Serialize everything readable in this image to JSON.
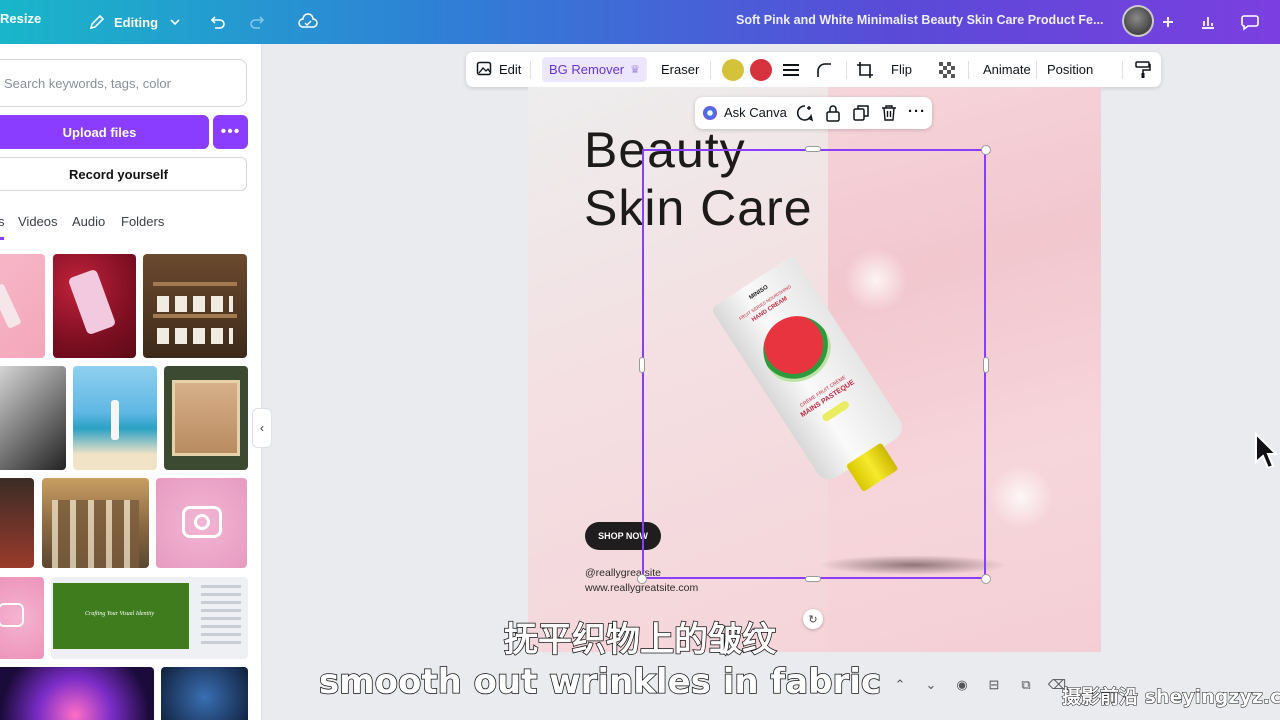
{
  "topbar": {
    "resize_label": "Resize",
    "editing_label": "Editing",
    "doc_title": "Soft Pink and White Minimalist Beauty Skin Care Product Fe..."
  },
  "panel": {
    "search_placeholder": "Search keywords, tags, color",
    "upload_label": "Upload files",
    "more_label": "•••",
    "record_label": "Record yourself",
    "tabs": [
      "s",
      "Videos",
      "Audio",
      "Folders"
    ]
  },
  "toolbar": {
    "edit_label": "Edit",
    "bg_remover_label": "BG Remover",
    "eraser_label": "Eraser",
    "flip_label": "Flip",
    "animate_label": "Animate",
    "position_label": "Position",
    "colors": [
      "#d4c23a",
      "#d6333f"
    ]
  },
  "ask": {
    "label": "Ask Canva"
  },
  "canvas": {
    "headline_1": "Beauty",
    "headline_2": "Skin Care",
    "shop_label": "SHOP NOW",
    "handle": "@reallygreatsite",
    "website": "www.reallygreatsite.com",
    "product": {
      "brand": "MINISO",
      "line1": "FRUIT SERIES NOURISHING",
      "line2": "HAND CREAM",
      "line3": "CRÈME FRUIT CRÈME",
      "line4": "MAINS PASTÈQUE"
    }
  },
  "subtitles": {
    "cn": "抚平织物上的皱纹",
    "en": "smooth out wrinkles in fabric"
  },
  "watermark": "摄影前沿 sheyingzyz.com"
}
